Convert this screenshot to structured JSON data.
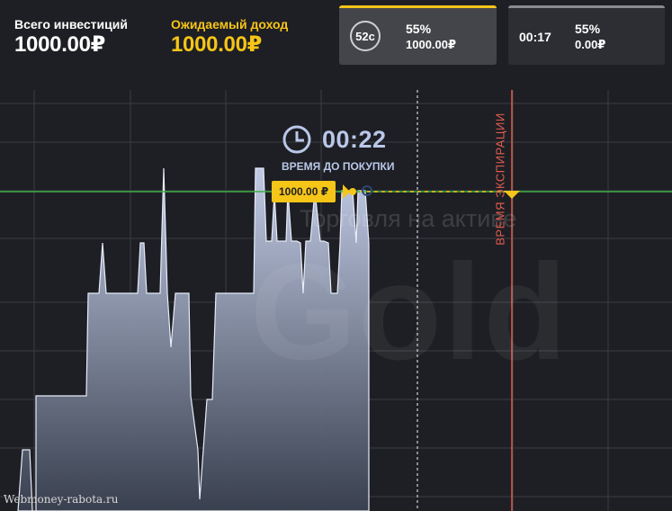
{
  "header": {
    "total_investments_label": "Всего инвестиций",
    "total_investments_value": "1000.00₽",
    "expected_income_label": "Ожидаемый доход",
    "expected_income_value": "1000.00₽"
  },
  "trades": [
    {
      "timer": "52c",
      "percent": "55%",
      "amount": "1000.00₽",
      "state": "active"
    },
    {
      "timer": "00:17",
      "percent": "55%",
      "amount": "0.00₽",
      "state": "inactive"
    }
  ],
  "chart_overlay": {
    "countdown": "00:22",
    "countdown_caption": "ВРЕМЯ ДО ПОКУПКИ",
    "price_tag": "1000.00 ₽",
    "asset_hint": "Торговля на активе",
    "asset_name": "Gold",
    "expiry_label": "ВРЕМЯ ЭКСПИРАЦИИ"
  },
  "watermark": "Webmoney-rabota.ru",
  "colors": {
    "background": "#1e1f24",
    "accent": "#f5c518",
    "level_line": "#3cb043",
    "expiry_line": "#e35b4f",
    "area_top": "#c9d3ee",
    "area_bottom": "#3a4150"
  },
  "icons": {
    "countdown": "clock-icon"
  }
}
